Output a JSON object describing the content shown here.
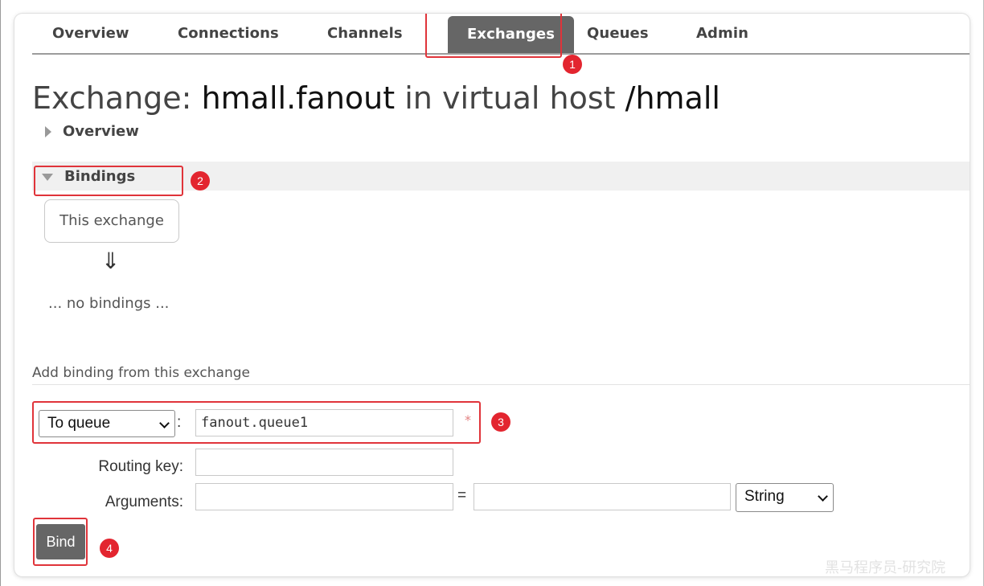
{
  "nav": {
    "tabs": [
      {
        "label": "Overview"
      },
      {
        "label": "Connections"
      },
      {
        "label": "Channels"
      },
      {
        "label": "Exchanges",
        "active": true
      },
      {
        "label": "Queues"
      },
      {
        "label": "Admin"
      }
    ]
  },
  "title": {
    "prefix": "Exchange:",
    "name": "hmall.fanout",
    "middle": "in virtual host",
    "vhost": "/hmall"
  },
  "sections": {
    "overview": "Overview",
    "bindings": "Bindings"
  },
  "bindings": {
    "source_box": "This exchange",
    "arrow": "⇓",
    "empty": "... no bindings ..."
  },
  "add_binding": {
    "heading": "Add binding from this exchange",
    "destination_type": "To queue",
    "colon": ":",
    "destination_value": "fanout.queue1",
    "required_mark": "*",
    "routing_key_label": "Routing key:",
    "routing_key_value": "",
    "arguments_label": "Arguments:",
    "equals": "=",
    "arg_type": "String",
    "bind_label": "Bind"
  },
  "annotations": [
    "1",
    "2",
    "3",
    "4"
  ],
  "watermark": "黑马程序员-研究院",
  "colors": {
    "accent_red": "#e3252f",
    "tab_active_bg": "#666666",
    "bind_button_bg": "#666666"
  }
}
